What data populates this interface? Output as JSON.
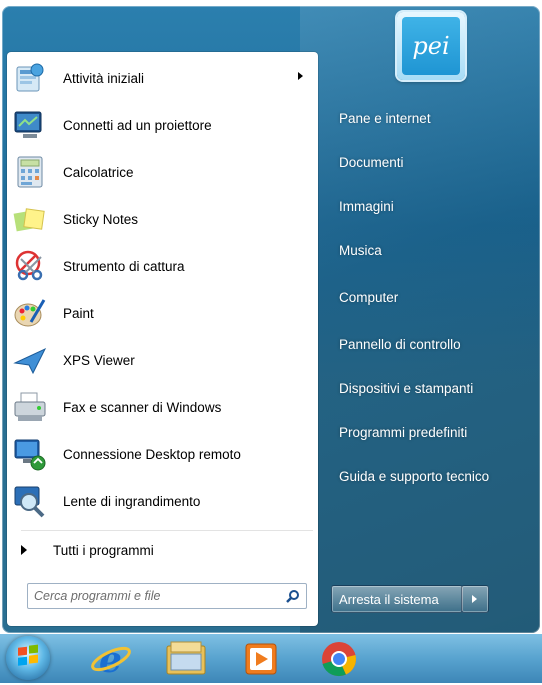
{
  "start_menu": {
    "programs": [
      {
        "label": "Attività iniziali",
        "icon": "getting-started-icon",
        "has_submenu": true
      },
      {
        "label": "Connetti ad un proiettore",
        "icon": "projector-icon"
      },
      {
        "label": "Calcolatrice",
        "icon": "calculator-icon"
      },
      {
        "label": "Sticky Notes",
        "icon": "sticky-notes-icon"
      },
      {
        "label": "Strumento di cattura",
        "icon": "snipping-tool-icon"
      },
      {
        "label": "Paint",
        "icon": "paint-icon"
      },
      {
        "label": "XPS Viewer",
        "icon": "xps-viewer-icon"
      },
      {
        "label": "Fax e scanner di Windows",
        "icon": "fax-scanner-icon"
      },
      {
        "label": "Connessione Desktop remoto",
        "icon": "remote-desktop-icon"
      },
      {
        "label": "Lente di ingrandimento",
        "icon": "magnifier-icon"
      }
    ],
    "all_programs_label": "Tutti i programmi",
    "search_placeholder": "Cerca programmi e file",
    "user_picture_text": "pei",
    "right_items": [
      "Pane e internet",
      "Documenti",
      "Immagini",
      "Musica",
      "Computer",
      "Pannello di controllo",
      "Dispositivi e stampanti",
      "Programmi predefiniti",
      "Guida e supporto tecnico"
    ],
    "shutdown_label": "Arresta il sistema"
  },
  "taskbar": {
    "items": [
      "start-orb-icon",
      "internet-explorer-icon",
      "file-explorer-icon",
      "media-player-icon",
      "chrome-icon"
    ]
  },
  "colors": {
    "frame": "#1f6b97",
    "taskbar": "#58a3cf",
    "right_text": "#ffffff"
  }
}
